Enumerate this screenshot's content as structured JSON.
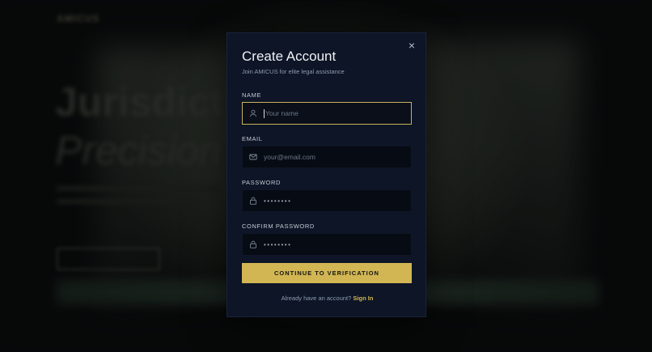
{
  "background": {
    "logo": "AMICUS",
    "nav": [
      "",
      ""
    ],
    "signin": "",
    "hero_line1": "Jurisdictio",
    "hero_line2": "Precision"
  },
  "modal": {
    "title": "Create Account",
    "subtitle": "Join AMICUS for elite legal assistance",
    "close_icon": "×",
    "fields": {
      "name": {
        "label": "NAME",
        "placeholder": "Your name",
        "icon": "user-icon"
      },
      "email": {
        "label": "EMAIL",
        "placeholder": "your@email.com",
        "icon": "mail-icon"
      },
      "password": {
        "label": "PASSWORD",
        "value": "••••••••",
        "icon": "lock-icon"
      },
      "confirm_password": {
        "label": "CONFIRM PASSWORD",
        "value": "••••••••",
        "icon": "lock-icon"
      }
    },
    "submit_label": "CONTINUE TO VERIFICATION",
    "footer_text": "Already have an account?",
    "footer_link": "Sign In"
  },
  "colors": {
    "modal_bg": "#0d1526",
    "accent": "#d1b653",
    "input_bg": "#070b14",
    "focus_border": "#c9b25a"
  }
}
